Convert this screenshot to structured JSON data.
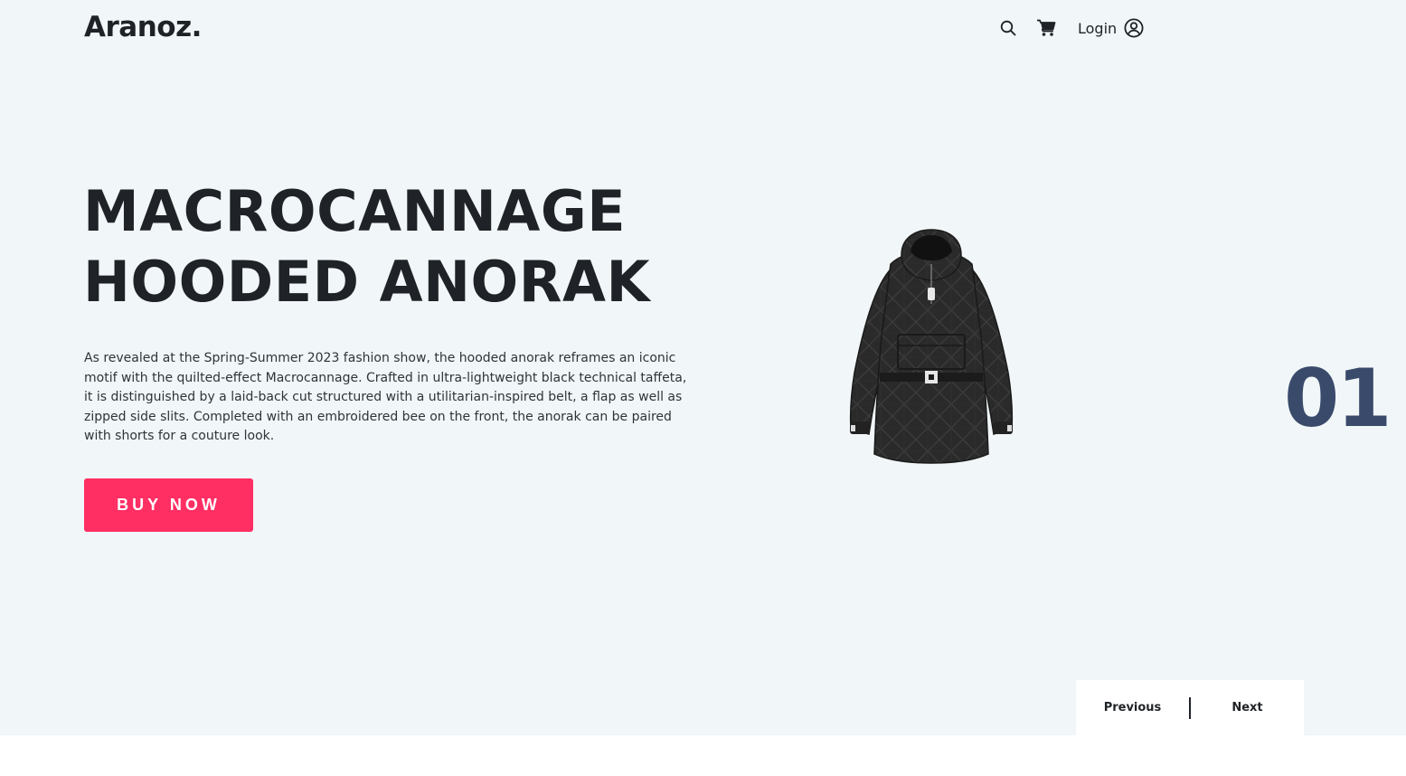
{
  "header": {
    "logo": "Aranoz.",
    "icons": [
      "search-icon",
      "cart-icon",
      "user-circle-icon"
    ],
    "login_label": "Login"
  },
  "hero": {
    "title_line1": "MACROCANNAGE",
    "title_line2": "HOODED ANORAK",
    "description": "As revealed at the Spring-Summer 2023 fashion show, the hooded anorak reframes an iconic motif with the quilted-effect Macrocannage. Crafted in ultra-lightweight black technical taffeta, it is distinguished by a laid-back cut structured with a utilitarian-inspired belt, a flap as well as zipped side slits. Completed with an embroidered bee on the front, the anorak can be paired with shorts for a couture look.",
    "buy_label": "BUY NOW",
    "slide_number": "01"
  },
  "pager": {
    "previous_label": "Previous",
    "next_label": "Next"
  },
  "colors": {
    "hero_background": "#f1f6f8",
    "accent": "#ff2e63",
    "slide_number": "#394a6b",
    "text_dark": "#1f2327"
  }
}
